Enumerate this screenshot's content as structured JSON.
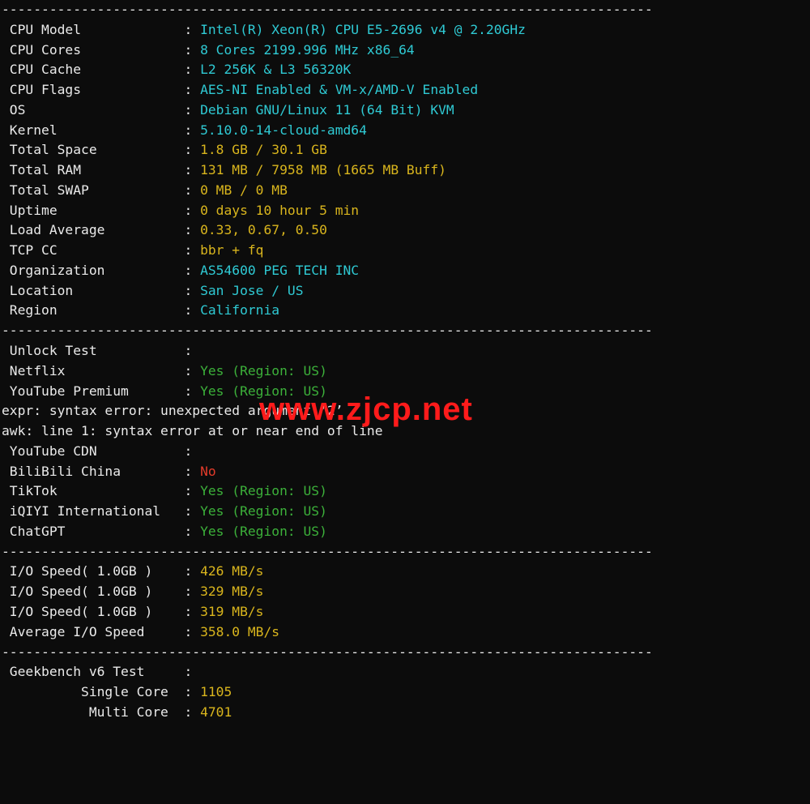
{
  "divider": "----------------------------------------------------------------------------------",
  "watermark": "www.zjcp.net",
  "system": [
    {
      "label": "CPU Model",
      "value": "Intel(R) Xeon(R) CPU E5-2696 v4 @ 2.20GHz",
      "color": "cyan"
    },
    {
      "label": "CPU Cores",
      "value": "8 Cores 2199.996 MHz x86_64",
      "color": "cyan"
    },
    {
      "label": "CPU Cache",
      "value": "L2 256K & L3 56320K",
      "color": "cyan"
    },
    {
      "label": "CPU Flags",
      "value": "AES-NI Enabled & VM-x/AMD-V Enabled",
      "color": "cyan"
    },
    {
      "label": "OS",
      "value": "Debian GNU/Linux 11 (64 Bit) KVM",
      "color": "cyan"
    },
    {
      "label": "Kernel",
      "value": "5.10.0-14-cloud-amd64",
      "color": "cyan"
    },
    {
      "label": "Total Space",
      "value": "1.8 GB / 30.1 GB",
      "color": "yellow"
    },
    {
      "label": "Total RAM",
      "value": "131 MB / 7958 MB (1665 MB Buff)",
      "color": "yellow"
    },
    {
      "label": "Total SWAP",
      "value": "0 MB / 0 MB",
      "color": "yellow"
    },
    {
      "label": "Uptime",
      "value": "0 days 10 hour 5 min",
      "color": "yellow"
    },
    {
      "label": "Load Average",
      "value": "0.33, 0.67, 0.50",
      "color": "yellow"
    },
    {
      "label": "TCP CC",
      "value": "bbr + fq",
      "color": "yellow"
    },
    {
      "label": "Organization",
      "value": "AS54600 PEG TECH INC",
      "color": "cyan"
    },
    {
      "label": "Location",
      "value": "San Jose / US",
      "color": "cyan"
    },
    {
      "label": "Region",
      "value": "California",
      "color": "cyan"
    }
  ],
  "unlock": {
    "header": {
      "label": "Unlock Test",
      "value": "",
      "color": "white"
    },
    "rows": [
      {
        "label": "Netflix",
        "value": "Yes (Region: US)",
        "color": "green"
      },
      {
        "label": "YouTube Premium",
        "value": "Yes (Region: US)",
        "color": "green"
      }
    ],
    "errors": [
      "expr: syntax error: unexpected argument ‘2’",
      "awk: line 1: syntax error at or near end of line"
    ],
    "rows2": [
      {
        "label": "YouTube CDN",
        "value": "",
        "color": "white"
      },
      {
        "label": "BiliBili China",
        "value": "No",
        "color": "red"
      },
      {
        "label": "TikTok",
        "value": "Yes (Region: US)",
        "color": "green"
      },
      {
        "label": "iQIYI International",
        "value": "Yes (Region: US)",
        "color": "green"
      },
      {
        "label": "ChatGPT",
        "value": "Yes (Region: US)",
        "color": "green"
      }
    ]
  },
  "io": [
    {
      "label": "I/O Speed( 1.0GB )",
      "value": "426 MB/s",
      "color": "yellow"
    },
    {
      "label": "I/O Speed( 1.0GB )",
      "value": "329 MB/s",
      "color": "yellow"
    },
    {
      "label": "I/O Speed( 1.0GB )",
      "value": "319 MB/s",
      "color": "yellow"
    },
    {
      "label": "Average I/O Speed",
      "value": "358.0 MB/s",
      "color": "yellow"
    }
  ],
  "geekbench": {
    "header": {
      "label": "Geekbench v6 Test",
      "value": "",
      "color": "white"
    },
    "rows": [
      {
        "label": "Single Core",
        "value": "1105",
        "color": "yellow",
        "align": "right"
      },
      {
        "label": "Multi Core",
        "value": "4701",
        "color": "yellow",
        "align": "right"
      }
    ]
  }
}
